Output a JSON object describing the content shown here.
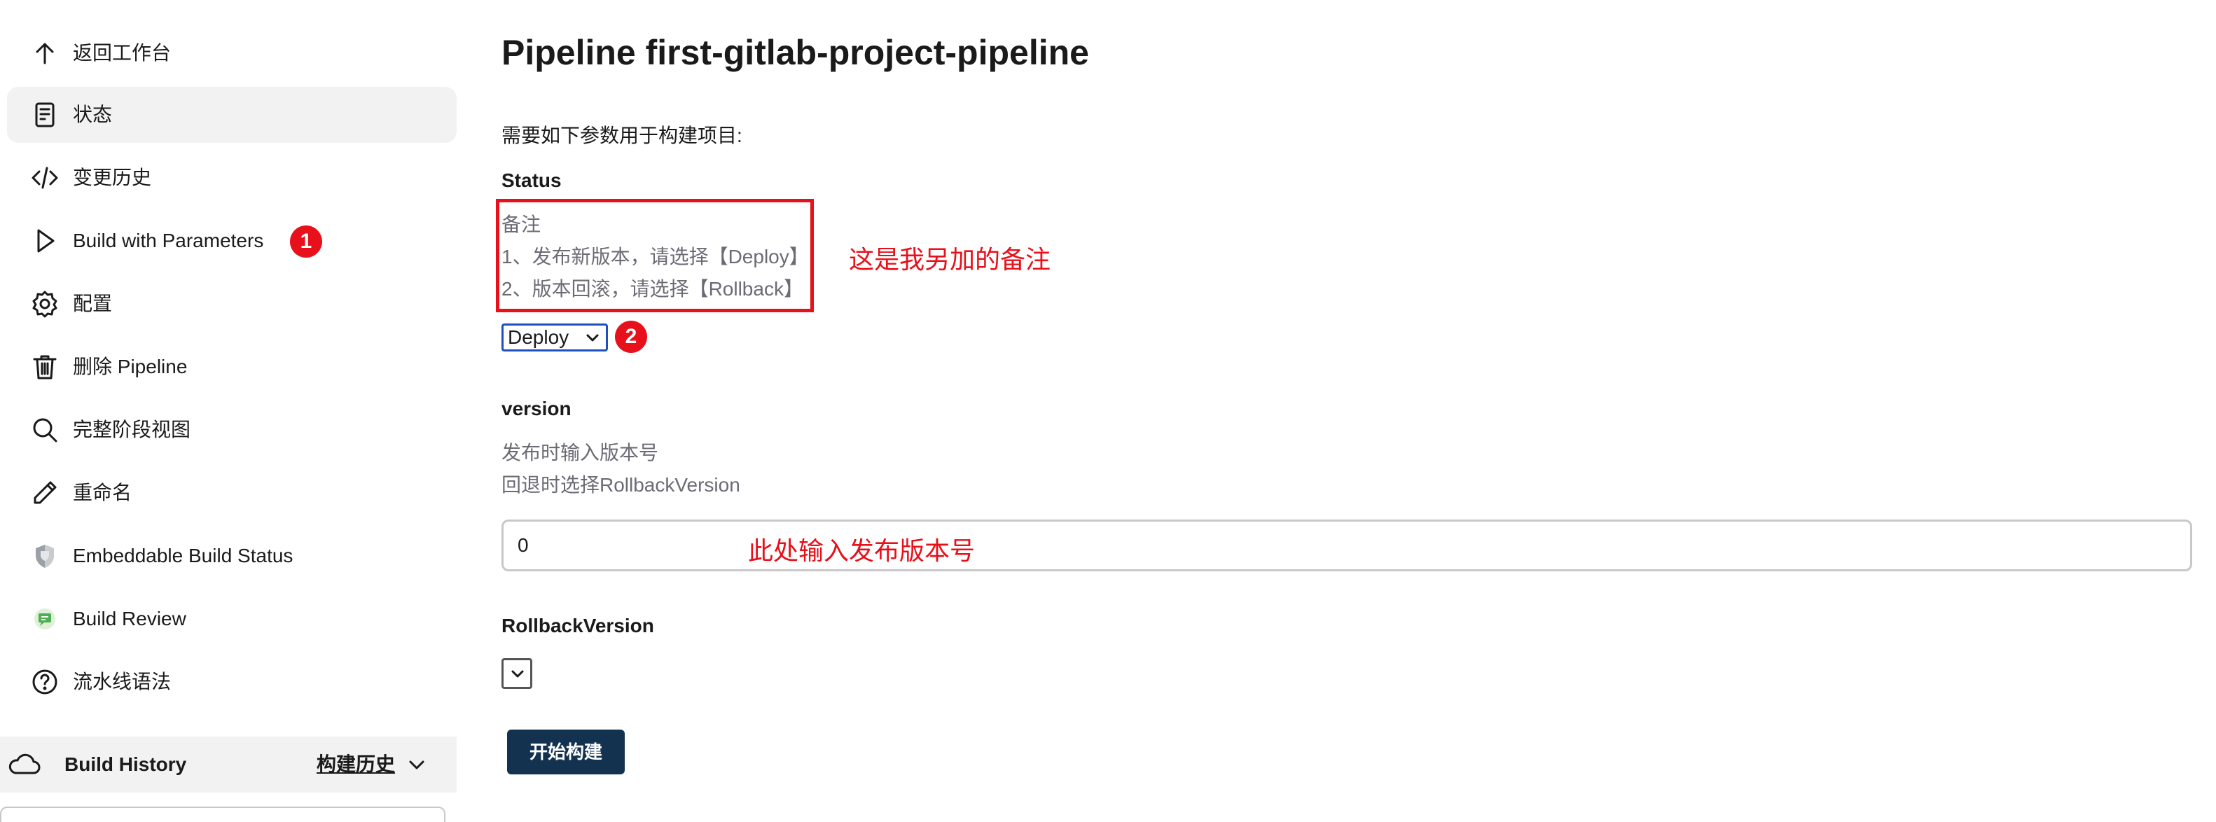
{
  "sidebar": {
    "items": [
      {
        "label": "返回工作台",
        "icon": "arrow-up-icon"
      },
      {
        "label": "状态",
        "icon": "document-icon",
        "active": true
      },
      {
        "label": "变更历史",
        "icon": "code-icon"
      },
      {
        "label": "Build with Parameters",
        "icon": "play-icon",
        "badge": "1"
      },
      {
        "label": "配置",
        "icon": "gear-icon"
      },
      {
        "label": "删除 Pipeline",
        "icon": "trash-icon"
      },
      {
        "label": "完整阶段视图",
        "icon": "search-icon"
      },
      {
        "label": "重命名",
        "icon": "pencil-icon"
      },
      {
        "label": "Embeddable Build Status",
        "icon": "shield-icon"
      },
      {
        "label": "Build Review",
        "icon": "review-icon"
      },
      {
        "label": "流水线语法",
        "icon": "help-icon"
      }
    ],
    "build_history": {
      "title": "Build History",
      "link": "构建历史"
    }
  },
  "main": {
    "title": "Pipeline first-gitlab-project-pipeline",
    "subtitle": "需要如下参数用于构建项目:",
    "status": {
      "name": "Status",
      "desc_lines": [
        "备注",
        "1、发布新版本，请选择【Deploy】",
        "2、版本回滚，请选择【Rollback】"
      ],
      "selected": "Deploy",
      "badge": "2",
      "annotation": "这是我另加的备注"
    },
    "version": {
      "name": "version",
      "desc_lines": [
        "发布时输入版本号",
        "回退时选择RollbackVersion"
      ],
      "value": "0",
      "annotation": "此处输入发布版本号"
    },
    "rollback": {
      "name": "RollbackVersion",
      "selected": ""
    },
    "build_button": "开始构建"
  },
  "colors": {
    "annotation_red": "#e8101a",
    "button_bg": "#12324f",
    "active_bg": "#f2f2f3",
    "select_border": "#1f50c0"
  }
}
